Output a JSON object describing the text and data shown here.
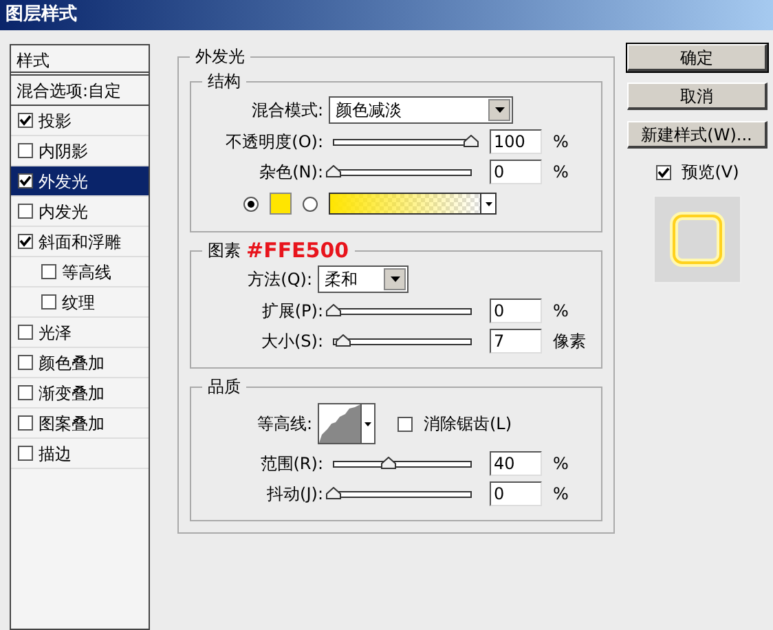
{
  "window": {
    "title": "图层样式"
  },
  "styles_list": [
    {
      "kind": "header",
      "label": "样式",
      "selected": false
    },
    {
      "kind": "option",
      "label": "混合选项:自定",
      "selected": false
    },
    {
      "kind": "check",
      "label": "投影",
      "checked": true,
      "selected": false
    },
    {
      "kind": "check",
      "label": "内阴影",
      "checked": false,
      "selected": false
    },
    {
      "kind": "check",
      "label": "外发光",
      "checked": true,
      "selected": true
    },
    {
      "kind": "check",
      "label": "内发光",
      "checked": false,
      "selected": false
    },
    {
      "kind": "check",
      "label": "斜面和浮雕",
      "checked": true,
      "selected": false,
      "children": [
        {
          "kind": "check",
          "label": "等高线",
          "checked": false,
          "selected": false
        },
        {
          "kind": "check",
          "label": "纹理",
          "checked": false,
          "selected": false
        }
      ]
    },
    {
      "kind": "check",
      "label": "光泽",
      "checked": false,
      "selected": false
    },
    {
      "kind": "check",
      "label": "颜色叠加",
      "checked": false,
      "selected": false
    },
    {
      "kind": "check",
      "label": "渐变叠加",
      "checked": false,
      "selected": false
    },
    {
      "kind": "check",
      "label": "图案叠加",
      "checked": false,
      "selected": false
    },
    {
      "kind": "check",
      "label": "描边",
      "checked": false,
      "selected": false
    }
  ],
  "panel": {
    "title": "外发光",
    "structure": {
      "title": "结构",
      "blend_mode": {
        "label": "混合模式:",
        "value": "颜色减淡"
      },
      "sliders": [
        {
          "label": "不透明度(O):",
          "level": 1,
          "value": "100",
          "unit": "%"
        },
        {
          "label": "杂色(N):",
          "level": 0,
          "value": "0",
          "unit": "%"
        }
      ],
      "fill": [
        {
          "kind": "solid",
          "selected": true,
          "color": "#ffe500"
        },
        {
          "kind": "gradient",
          "selected": false
        }
      ]
    },
    "elements": {
      "title": "图素",
      "annotation": "#FFE500",
      "method": {
        "label": "方法(Q):",
        "value": "柔和"
      },
      "sliders": [
        {
          "label": "扩展(P):",
          "level": 0,
          "value": "0",
          "unit": "%"
        },
        {
          "label": "大小(S):",
          "level": 0.07,
          "value": "7",
          "unit": "像素"
        }
      ]
    },
    "quality": {
      "title": "品质",
      "contour": {
        "label": "等高线:"
      },
      "anti_alias": {
        "label": "消除锯齿(L)",
        "checked": false
      },
      "sliders": [
        {
          "label": "范围(R):",
          "level": 0.4,
          "value": "40",
          "unit": "%"
        },
        {
          "label": "抖动(J):",
          "level": 0,
          "value": "0",
          "unit": "%"
        }
      ]
    }
  },
  "buttons": [
    {
      "label": "确定",
      "selected": true
    },
    {
      "label": "取消",
      "selected": false
    },
    {
      "label": "新建样式(W)...",
      "selected": false
    }
  ],
  "preview": {
    "label": "预览(V)",
    "checked": true
  }
}
